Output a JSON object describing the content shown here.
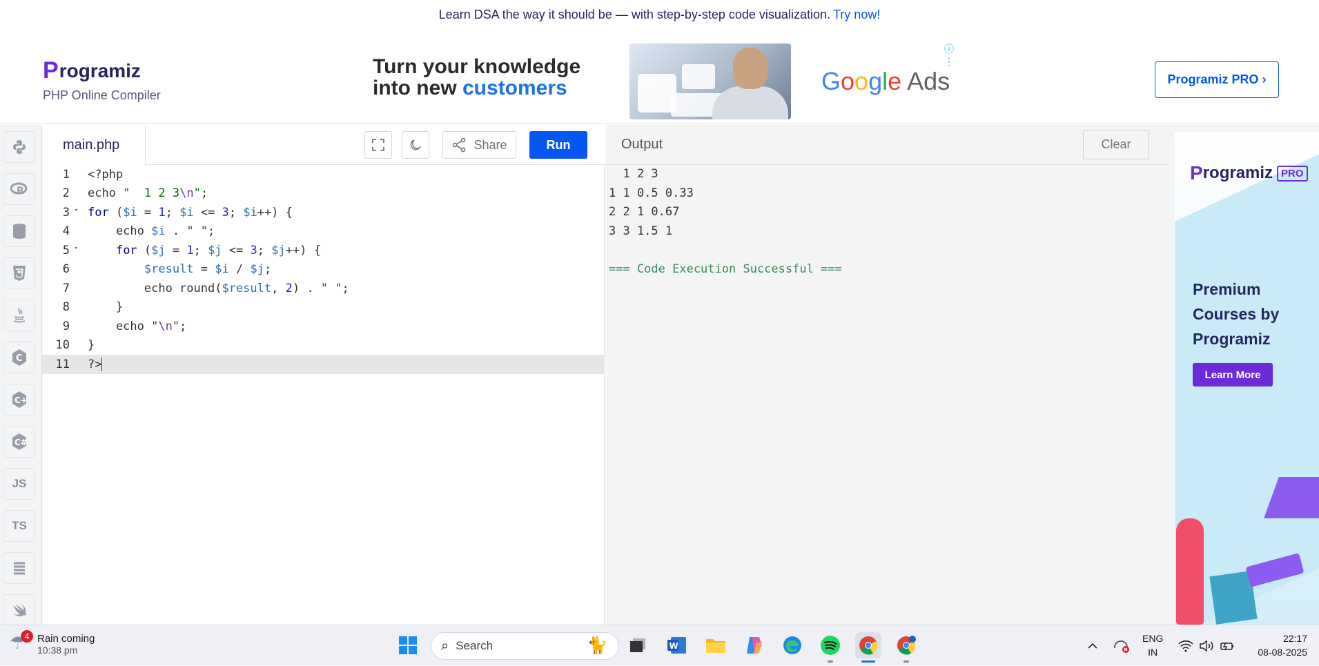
{
  "top_banner": {
    "text": "Learn DSA the way it should be — with step-by-step code visualization.",
    "link": "Try now!"
  },
  "header": {
    "logo_text": "rogramiz",
    "logo_p": "P",
    "subtitle": "PHP Online Compiler",
    "pro_button": "Programiz PRO ›"
  },
  "ad": {
    "headline_line1": "Turn your knowledge",
    "headline_line2_prefix": "into new ",
    "headline_line2_highlight": "customers",
    "brand": [
      "G",
      "o",
      "o",
      "g",
      "l",
      "e"
    ],
    "brand_suffix": " Ads"
  },
  "language_sidebar": [
    "python-icon",
    "r-icon",
    "sql-icon",
    "html5-icon",
    "java-icon",
    "c-icon",
    "cpp-icon",
    "csharp-icon",
    "js-icon",
    "ts-icon",
    "go-icon",
    "swift-icon"
  ],
  "language_labels": {
    "js": "JS",
    "ts": "TS"
  },
  "editor": {
    "file_name": "main.php",
    "share_label": "Share",
    "run_label": "Run",
    "line_numbers": [
      "1",
      "2",
      "3",
      "4",
      "5",
      "6",
      "7",
      "8",
      "9",
      "10",
      "11"
    ],
    "active_line": 11
  },
  "output": {
    "title": "Output",
    "clear_label": "Clear",
    "lines": [
      "  1 2 3",
      "1 1 0.5 0.33",
      "2 2 1 0.67",
      "3 3 1.5 1"
    ],
    "status": "=== Code Execution Successful ==="
  },
  "side_ad": {
    "logo_p": "P",
    "logo_text": "rogramiz",
    "badge": "PRO",
    "heading": "Premium Courses by Programiz",
    "button": "Learn More"
  },
  "taskbar": {
    "weather_title": "Rain coming",
    "weather_time": "10:38 pm",
    "weather_badge": "4",
    "search_placeholder": "Search",
    "lang_line1": "ENG",
    "lang_line2": "IN",
    "time": "22:17",
    "date": "08-08-2025"
  }
}
